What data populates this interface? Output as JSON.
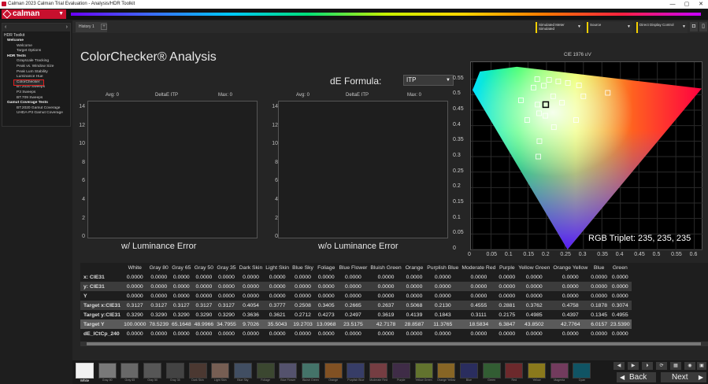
{
  "window": {
    "title": "Calman 2023 Calman Trial Evaluation - Analysis/HDR Toolkit",
    "controls": [
      "—",
      "▢",
      "✕"
    ]
  },
  "app": {
    "logo": "calman"
  },
  "tabs": {
    "doc_tab": "History 1",
    "plus": "+"
  },
  "toolbar": {
    "meter": "Simulated Meter Simulated",
    "source": "Source",
    "display": "Direct Display Control"
  },
  "sidebar": {
    "title": "HDR Toolkit",
    "items": [
      {
        "type": "grp",
        "label": "Welcome"
      },
      {
        "type": "it",
        "label": "Welcome"
      },
      {
        "type": "it",
        "label": "Target Options"
      },
      {
        "type": "grp",
        "label": "HDR Tests"
      },
      {
        "type": "it",
        "label": "Grayscale Tracking"
      },
      {
        "type": "it",
        "label": "Peak vs. Window Size"
      },
      {
        "type": "it",
        "label": "Peak Lum Stability"
      },
      {
        "type": "it",
        "label": "Luminance Hue"
      },
      {
        "type": "sel",
        "label": "ColorChecker"
      },
      {
        "type": "it",
        "label": "BT.2020 Sweeps"
      },
      {
        "type": "it",
        "label": "P3 Sweeps"
      },
      {
        "type": "it",
        "label": "BT.709 Sweeps"
      },
      {
        "type": "grp",
        "label": "Gamut Coverage Tests"
      },
      {
        "type": "it",
        "label": "BT.2020 Gamut Coverage"
      },
      {
        "type": "it",
        "label": "UHDA-P3 Gamut Coverage"
      }
    ]
  },
  "main": {
    "title": "ColorChecker® Analysis",
    "de_formula_label": "dE Formula:",
    "de_formula_value": "ITP",
    "plot1": {
      "avg": "Avg: 0",
      "name": "DeltaE ITP",
      "max": "Max: 0",
      "caption": "w/ Luminance Error"
    },
    "plot2": {
      "avg": "Avg: 0",
      "name": "DeltaE ITP",
      "max": "Max: 0",
      "caption": "w/o Luminance Error"
    },
    "y_ticks": [
      "14",
      "12",
      "10",
      "8",
      "6",
      "4",
      "2",
      "0"
    ],
    "rgb_triplet": "RGB Triplet: 235, 235, 235"
  },
  "chart_data": {
    "type": "scatter",
    "title": "CIE 1976 u'v'",
    "x_ticks": [
      "0",
      "0.05",
      "0.1",
      "0.15",
      "0.2",
      "0.25",
      "0.3",
      "0.35",
      "0.4",
      "0.45",
      "0.5",
      "0.55",
      "0.6"
    ],
    "y_ticks": [
      "0.55",
      "0.5",
      "0.45",
      "0.4",
      "0.35",
      "0.3",
      "0.25",
      "0.2",
      "0.15",
      "0.1",
      "0.05",
      "0"
    ],
    "xlim": [
      0,
      0.62
    ],
    "ylim": [
      0,
      0.6
    ],
    "gamut": [
      [
        0.257,
        0.0
      ],
      [
        0.0,
        0.515
      ],
      [
        0.02,
        0.575
      ],
      [
        0.12,
        0.59
      ],
      [
        0.62,
        0.52
      ]
    ],
    "points": [
      {
        "u": 0.131,
        "v": 0.482
      },
      {
        "u": 0.165,
        "v": 0.523
      },
      {
        "u": 0.193,
        "v": 0.529
      },
      {
        "u": 0.232,
        "v": 0.543
      },
      {
        "u": 0.258,
        "v": 0.538
      },
      {
        "u": 0.288,
        "v": 0.53
      },
      {
        "u": 0.175,
        "v": 0.55
      },
      {
        "u": 0.207,
        "v": 0.548
      },
      {
        "u": 0.242,
        "v": 0.474
      },
      {
        "u": 0.218,
        "v": 0.495
      },
      {
        "u": 0.3,
        "v": 0.495
      },
      {
        "u": 0.366,
        "v": 0.506
      },
      {
        "u": 0.176,
        "v": 0.468
      },
      {
        "u": 0.18,
        "v": 0.44
      },
      {
        "u": 0.197,
        "v": 0.432
      },
      {
        "u": 0.148,
        "v": 0.418
      },
      {
        "u": 0.22,
        "v": 0.395
      },
      {
        "u": 0.28,
        "v": 0.418
      },
      {
        "u": 0.181,
        "v": 0.35
      },
      {
        "u": 0.178,
        "v": 0.3
      }
    ],
    "current_point": {
      "u": 0.198,
      "v": 0.468
    }
  },
  "table": {
    "columns": [
      "",
      "White",
      "Gray 80",
      "Gray 65",
      "Gray 50",
      "Gray 35",
      "Dark Skin",
      "Light Skin",
      "Blue Sky",
      "Foliage",
      "Blue Flower",
      "Bluish Green",
      "Orange",
      "Purplish Blue",
      "Moderate Red",
      "Purple",
      "Yellow Green",
      "Orange Yellow",
      "Blue",
      "Green"
    ],
    "rows": [
      {
        "label": "x: CIE31",
        "values": [
          "0.0000",
          "0.0000",
          "0.0000",
          "0.0000",
          "0.0000",
          "0.0000",
          "0.0000",
          "0.0000",
          "0.0000",
          "0.0000",
          "0.0000",
          "0.0000",
          "0.0000",
          "0.0000",
          "0.0000",
          "0.0000",
          "0.0000",
          "0.0000",
          "0.0000"
        ]
      },
      {
        "label": "y: CIE31",
        "values": [
          "0.0000",
          "0.0000",
          "0.0000",
          "0.0000",
          "0.0000",
          "0.0000",
          "0.0000",
          "0.0000",
          "0.0000",
          "0.0000",
          "0.0000",
          "0.0000",
          "0.0000",
          "0.0000",
          "0.0000",
          "0.0000",
          "0.0000",
          "0.0000",
          "0.0000"
        ]
      },
      {
        "label": "Y",
        "values": [
          "0.0000",
          "0.0000",
          "0.0000",
          "0.0000",
          "0.0000",
          "0.0000",
          "0.0000",
          "0.0000",
          "0.0000",
          "0.0000",
          "0.0000",
          "0.0000",
          "0.0000",
          "0.0000",
          "0.0000",
          "0.0000",
          "0.0000",
          "0.0000",
          "0.0000"
        ]
      },
      {
        "label": "Target x:CIE31",
        "values": [
          "0.3127",
          "0.3127",
          "0.3127",
          "0.3127",
          "0.3127",
          "0.4054",
          "0.3777",
          "0.2508",
          "0.3405",
          "0.2665",
          "0.2637",
          "0.5068",
          "0.2130",
          "0.4555",
          "0.2881",
          "0.3762",
          "0.4758",
          "0.1878",
          "0.3074"
        ]
      },
      {
        "label": "Target y:CIE31",
        "values": [
          "0.3290",
          "0.3290",
          "0.3290",
          "0.3290",
          "0.3290",
          "0.3636",
          "0.3621",
          "0.2712",
          "0.4273",
          "0.2497",
          "0.3619",
          "0.4139",
          "0.1843",
          "0.3111",
          "0.2175",
          "0.4985",
          "0.4397",
          "0.1345",
          "0.4955"
        ]
      },
      {
        "label": "Target Y",
        "values": [
          "100.0000",
          "78.5239",
          "65.1648",
          "48.9966",
          "34.7955",
          "9.7026",
          "35.5043",
          "19.2703",
          "13.0968",
          "23.5175",
          "42.7178",
          "28.8587",
          "11.3765",
          "18.5834",
          "6.3847",
          "43.8502",
          "42.7764",
          "6.0157",
          "23.5390"
        ]
      },
      {
        "label": "dE_ICtCp_240",
        "values": [
          "0.0000",
          "0.0000",
          "0.0000",
          "0.0000",
          "0.0000",
          "0.0000",
          "0.0000",
          "0.0000",
          "0.0000",
          "0.0000",
          "0.0000",
          "0.0000",
          "0.0000",
          "0.0000",
          "0.0000",
          "0.0000",
          "0.0000",
          "0.0000",
          "0.0000"
        ]
      }
    ]
  },
  "swatches": [
    {
      "label": "White",
      "color": "#f2f2f2"
    },
    {
      "label": "Gray 80",
      "color": "#c8c8c8"
    },
    {
      "label": "Gray 65",
      "color": "#a8a8a8"
    },
    {
      "label": "Gray 50",
      "color": "#888888"
    },
    {
      "label": "Gray 35",
      "color": "#666666"
    },
    {
      "label": "Dark Skin",
      "color": "#735244"
    },
    {
      "label": "Light Skin",
      "color": "#c29682"
    },
    {
      "label": "Blue Sky",
      "color": "#627a9d"
    },
    {
      "label": "Foliage",
      "color": "#576c43"
    },
    {
      "label": "Blue Flower",
      "color": "#8580b1"
    },
    {
      "label": "Bluish Green",
      "color": "#67bdaa"
    },
    {
      "label": "Orange",
      "color": "#d67e2c"
    },
    {
      "label": "Purplish Blue",
      "color": "#505ba6"
    },
    {
      "label": "Moderate Red",
      "color": "#c15a63"
    },
    {
      "label": "Purple",
      "color": "#5e3c6c"
    },
    {
      "label": "Yellow Green",
      "color": "#9dbc40"
    },
    {
      "label": "Orange Yellow",
      "color": "#e0a32e"
    },
    {
      "label": "Blue",
      "color": "#383d96"
    },
    {
      "label": "Green",
      "color": "#469449"
    },
    {
      "label": "Red",
      "color": "#af363c"
    },
    {
      "label": "Yellow",
      "color": "#e7c71f"
    },
    {
      "label": "Magenta",
      "color": "#bb5695"
    },
    {
      "label": "Cyan",
      "color": "#0885a1"
    }
  ],
  "nav": {
    "back": "Back",
    "next": "Next",
    "small_buttons": [
      "◀",
      "▶",
      "⏵",
      "⟳",
      "▦",
      "◉",
      "▣"
    ]
  }
}
